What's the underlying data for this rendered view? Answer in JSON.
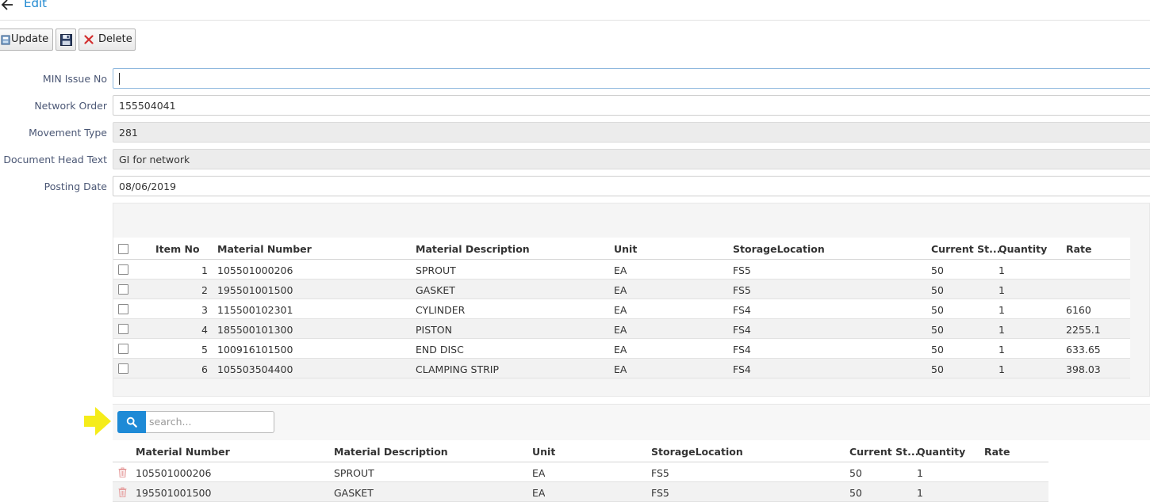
{
  "header": {
    "title": "Edit"
  },
  "toolbar": {
    "update_label": "Update",
    "delete_label": "Delete"
  },
  "form": {
    "min_issue_no": {
      "label": "MIN Issue No",
      "value": ""
    },
    "network_order": {
      "label": "Network Order",
      "value": "155504041"
    },
    "movement_type": {
      "label": "Movement Type",
      "value": "281"
    },
    "doc_head_text": {
      "label": "Document Head Text",
      "value": "GI for network"
    },
    "posting_date": {
      "label": "Posting Date",
      "value": "08/06/2019"
    }
  },
  "items_grid": {
    "columns": {
      "item_no": "Item No",
      "material_number": "Material Number",
      "material_description": "Material Description",
      "unit": "Unit",
      "storage_location": "StorageLocation",
      "current_stock": "Current St...",
      "quantity": "Quantity",
      "rate": "Rate"
    },
    "rows": [
      {
        "item_no": "1",
        "material_number": "105501000206",
        "material_description": "SPROUT",
        "unit": "EA",
        "storage_location": "FS5",
        "current_stock": "50",
        "quantity": "1",
        "rate": ""
      },
      {
        "item_no": "2",
        "material_number": "195501001500",
        "material_description": "GASKET",
        "unit": "EA",
        "storage_location": "FS5",
        "current_stock": "50",
        "quantity": "1",
        "rate": ""
      },
      {
        "item_no": "3",
        "material_number": "115500102301",
        "material_description": "CYLINDER",
        "unit": "EA",
        "storage_location": "FS4",
        "current_stock": "50",
        "quantity": "1",
        "rate": "6160"
      },
      {
        "item_no": "4",
        "material_number": "185500101300",
        "material_description": "PISTON",
        "unit": "EA",
        "storage_location": "FS4",
        "current_stock": "50",
        "quantity": "1",
        "rate": "2255.1"
      },
      {
        "item_no": "5",
        "material_number": "100916101500",
        "material_description": "END DISC",
        "unit": "EA",
        "storage_location": "FS4",
        "current_stock": "50",
        "quantity": "1",
        "rate": "633.65"
      },
      {
        "item_no": "6",
        "material_number": "105503504400",
        "material_description": "CLAMPING STRIP",
        "unit": "EA",
        "storage_location": "FS4",
        "current_stock": "50",
        "quantity": "1",
        "rate": "398.03"
      }
    ]
  },
  "search": {
    "placeholder": "search..."
  },
  "selected_grid": {
    "columns": {
      "material_number": "Material Number",
      "material_description": "Material Description",
      "unit": "Unit",
      "storage_location": "StorageLocation",
      "current_stock": "Current St...",
      "quantity": "Quantity",
      "rate": "Rate"
    },
    "rows": [
      {
        "material_number": "105501000206",
        "material_description": "SPROUT",
        "unit": "EA",
        "storage_location": "FS5",
        "current_stock": "50",
        "quantity": "1",
        "rate": ""
      },
      {
        "material_number": "195501001500",
        "material_description": "GASKET",
        "unit": "EA",
        "storage_location": "FS5",
        "current_stock": "50",
        "quantity": "1",
        "rate": ""
      }
    ]
  },
  "colors": {
    "accent": "#1e88d0",
    "label": "#4b5775",
    "search_button": "#1e8ad6",
    "marker": "#f5ec1a",
    "delete_red": "#d32f2f"
  },
  "icons": {
    "back": "arrow-left-icon",
    "update": "update-icon",
    "save": "floppy-disk-icon",
    "delete": "x-icon",
    "search": "magnifier-icon",
    "row_delete": "trash-icon"
  }
}
